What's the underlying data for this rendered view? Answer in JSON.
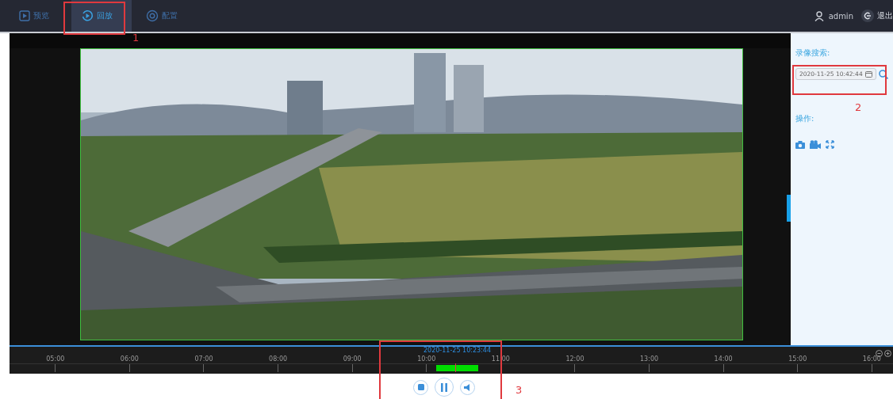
{
  "nav": {
    "tabs": [
      {
        "label": "预览",
        "selected": false
      },
      {
        "label": "回放",
        "selected": true
      },
      {
        "label": "配置",
        "selected": false
      }
    ],
    "user": "admin",
    "logout": "退出"
  },
  "side_panel": {
    "search_title": "录像搜索:",
    "date_value": "2020-11-25 10:42:44",
    "actions_title": "操作:"
  },
  "timeline": {
    "current_time": "2020-11-25 10:23:44",
    "ticks": [
      "05:00",
      "06:00",
      "07:00",
      "08:00",
      "09:00",
      "10:00",
      "11:00",
      "12:00",
      "13:00",
      "14:00",
      "15:00",
      "16:00"
    ]
  },
  "annotations": [
    "1",
    "2",
    "3"
  ]
}
